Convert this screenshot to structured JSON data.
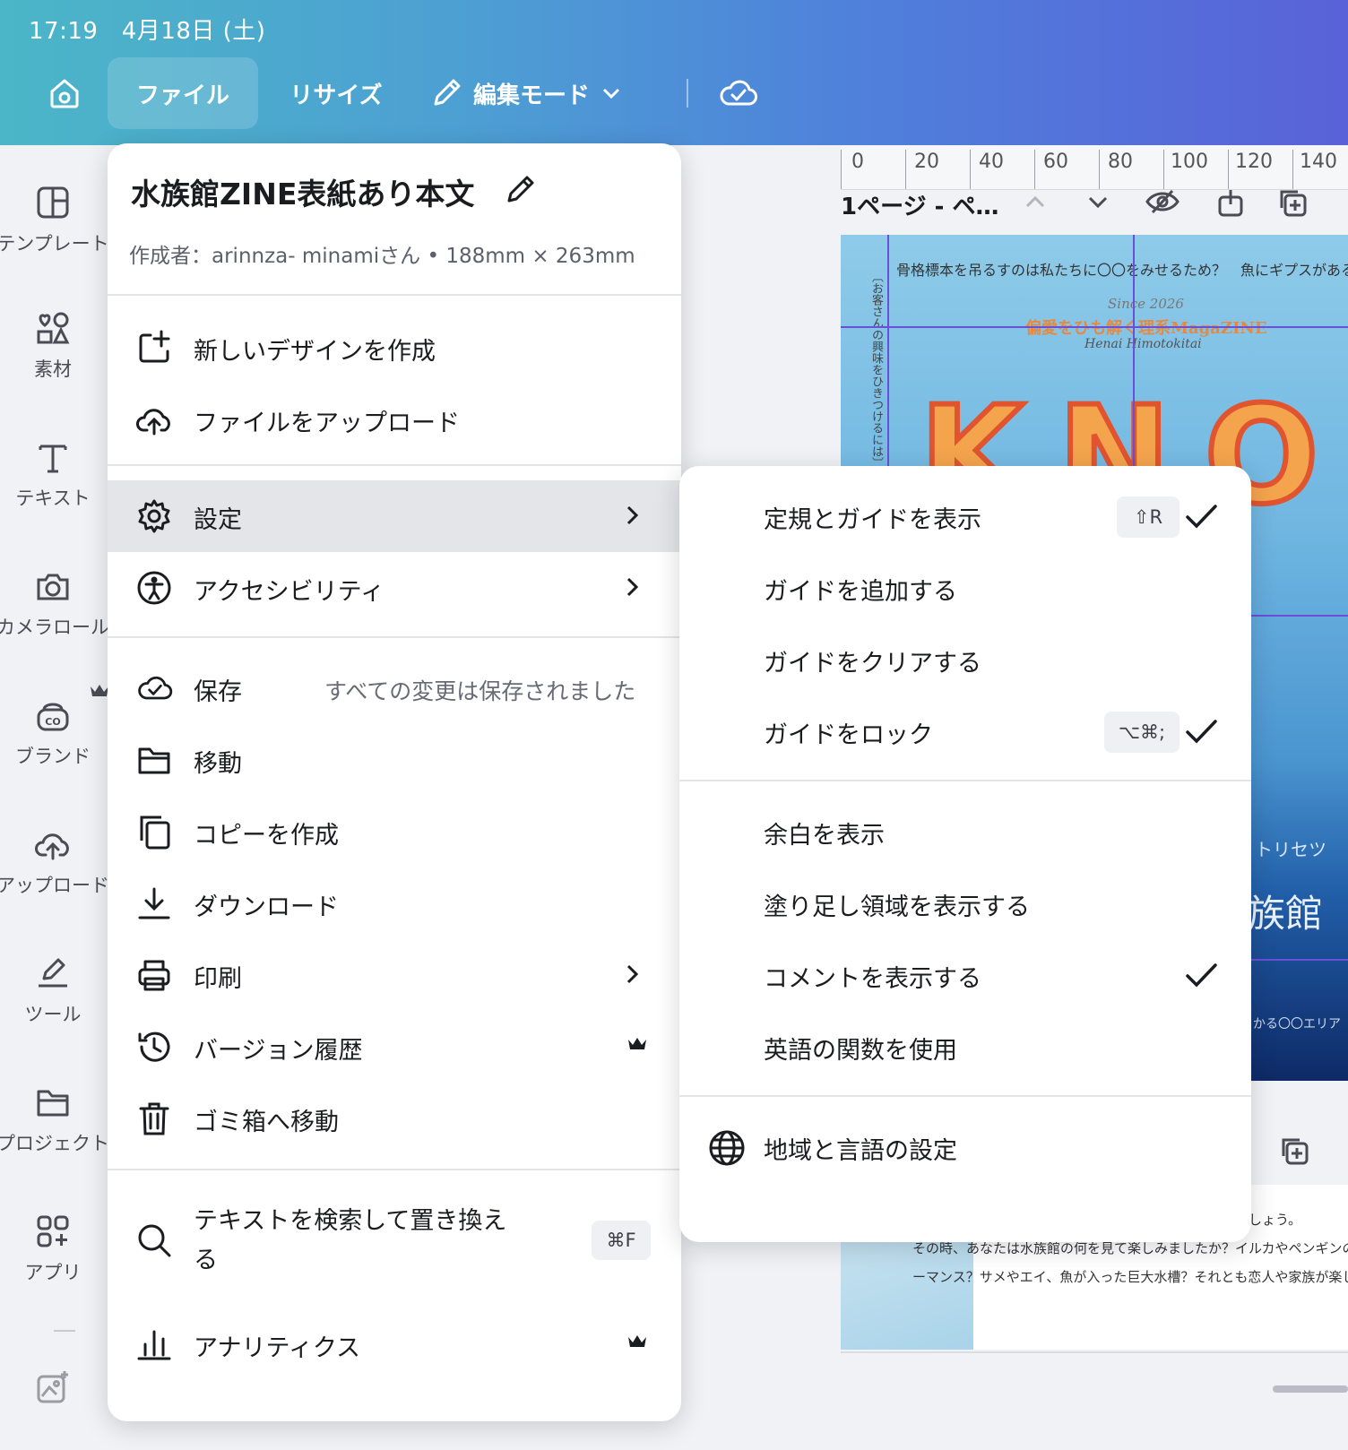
{
  "status": {
    "time": "17:19",
    "date": "4月18日 (土)"
  },
  "toolbar": {
    "file_label": "ファイル",
    "resize_label": "リサイズ",
    "edit_mode_label": "編集モード"
  },
  "sidebar": {
    "items": [
      {
        "label": "テンプレート",
        "icon": "template-icon"
      },
      {
        "label": "素材",
        "icon": "elements-icon"
      },
      {
        "label": "テキスト",
        "icon": "text-icon"
      },
      {
        "label": "カメラロール",
        "icon": "camera-icon"
      },
      {
        "label": "ブランド",
        "icon": "brand-icon"
      },
      {
        "label": "アップロード",
        "icon": "upload-icon"
      },
      {
        "label": "ツール",
        "icon": "tools-icon"
      },
      {
        "label": "プロジェクト",
        "icon": "folder-icon"
      },
      {
        "label": "アプリ",
        "icon": "apps-icon"
      }
    ]
  },
  "ruler": {
    "ticks": [
      "0",
      "20",
      "40",
      "60",
      "80",
      "100",
      "120",
      "140"
    ]
  },
  "canvas": {
    "page_label": "1ページ - ペ…",
    "cover": {
      "top_line": "骨格標本を吊るすのは私たちに〇〇をみせるため？　魚にギプスがあるって",
      "since": "Since 2026",
      "tagline": "偏愛をひも解く理系MagaZINE",
      "byline": "Henai Himotokitai",
      "big_word": "KNOT",
      "side_vertical": "〔お客さんの興味をひきつけるには〕",
      "torisetsu": "トリセツ",
      "aquarium": "族館",
      "area": "かる〇〇エリア"
    },
    "page2_lines": [
      "あなたが最後に水族館を訪れたのはいつでしょう。",
      "その時、あなたは水族館の何を見て楽しみましたか？イルカやペンギンの",
      "ーマンス？サメやエイ、魚が入った巨大水槽？それとも恋人や家族が楽し"
    ]
  },
  "file_menu": {
    "title": "水族館ZINE表紙あり本文",
    "meta": "作成者：arinnza- minamiさん • 188mm × 263mm",
    "items": {
      "new_design": "新しいデザインを作成",
      "upload": "ファイルをアップロード",
      "settings": "設定",
      "accessibility": "アクセシビリティ",
      "save": "保存",
      "save_status": "すべての変更は保存されました",
      "move": "移動",
      "copy": "コピーを作成",
      "download": "ダウンロード",
      "print": "印刷",
      "version_history": "バージョン履歴",
      "trash": "ゴミ箱へ移動",
      "find_replace_1": "テキストを検索して置き換え",
      "find_replace_2": "る",
      "find_replace_shortcut": "⌘F",
      "analytics": "アナリティクス"
    }
  },
  "settings_menu": {
    "items": [
      {
        "label": "定規とガイドを表示",
        "shortcut": "⇧R",
        "checked": true
      },
      {
        "label": "ガイドを追加する",
        "shortcut": "",
        "checked": false
      },
      {
        "label": "ガイドをクリアする",
        "shortcut": "",
        "checked": false
      },
      {
        "label": "ガイドをロック",
        "shortcut": "⌥⌘;",
        "checked": true
      },
      {
        "label": "余白を表示",
        "shortcut": "",
        "checked": false
      },
      {
        "label": "塗り足し領域を表示する",
        "shortcut": "",
        "checked": false
      },
      {
        "label": "コメントを表示する",
        "shortcut": "",
        "checked": true
      },
      {
        "label": "英語の関数を使用",
        "shortcut": "",
        "checked": false
      }
    ],
    "region_language": "地域と言語の設定"
  },
  "colors": {
    "accent_gradient_start": "#4bb6c7",
    "accent_gradient_end": "#5962d8",
    "highlight": "#e4e5e9"
  }
}
